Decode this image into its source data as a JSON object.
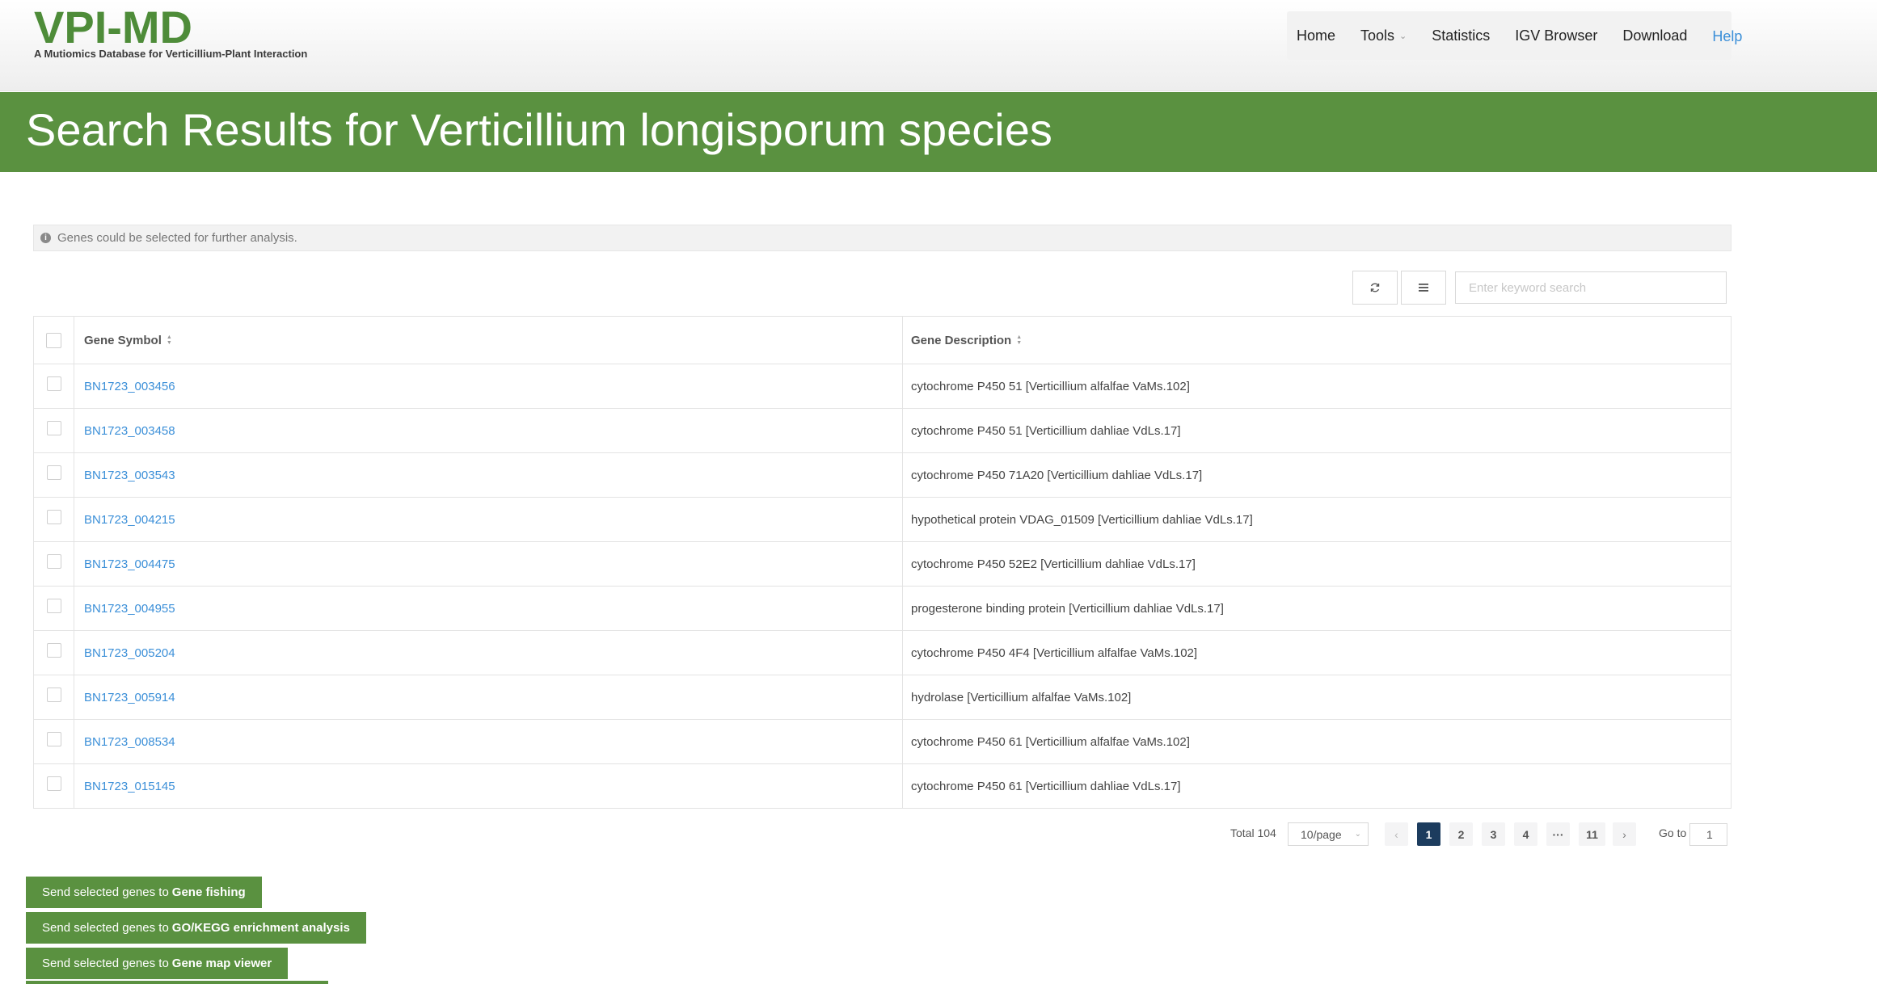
{
  "header": {
    "logo_title": "VPI-MD",
    "logo_subtitle": "A Mutiomics Database for Verticillium-Plant Interaction",
    "nav": [
      {
        "label": "Home"
      },
      {
        "label": "Tools",
        "has_dropdown": true
      },
      {
        "label": "Statistics"
      },
      {
        "label": "IGV Browser"
      },
      {
        "label": "Download"
      },
      {
        "label": "Help",
        "active": true
      }
    ]
  },
  "banner": {
    "title": "Search Results for Verticillium longisporum species"
  },
  "info": {
    "text": "Genes could be selected for further analysis.",
    "icon": "info-circle-icon"
  },
  "toolbar": {
    "refresh_icon": "refresh-icon",
    "columns_icon": "list-icon",
    "search_placeholder": "Enter keyword search",
    "search_value": ""
  },
  "table": {
    "headers": {
      "symbol": "Gene Symbol",
      "description": "Gene Description"
    },
    "rows": [
      {
        "symbol": "BN1723_003456",
        "description": "cytochrome P450 51 [Verticillium alfalfae VaMs.102]"
      },
      {
        "symbol": "BN1723_003458",
        "description": "cytochrome P450 51 [Verticillium dahliae VdLs.17]"
      },
      {
        "symbol": "BN1723_003543",
        "description": "cytochrome P450 71A20 [Verticillium dahliae VdLs.17]"
      },
      {
        "symbol": "BN1723_004215",
        "description": "hypothetical protein VDAG_01509 [Verticillium dahliae VdLs.17]"
      },
      {
        "symbol": "BN1723_004475",
        "description": "cytochrome P450 52E2 [Verticillium dahliae VdLs.17]"
      },
      {
        "symbol": "BN1723_004955",
        "description": "progesterone binding protein [Verticillium dahliae VdLs.17]"
      },
      {
        "symbol": "BN1723_005204",
        "description": "cytochrome P450 4F4 [Verticillium alfalfae VaMs.102]"
      },
      {
        "symbol": "BN1723_005914",
        "description": "hydrolase [Verticillium alfalfae VaMs.102]"
      },
      {
        "symbol": "BN1723_008534",
        "description": "cytochrome P450 61 [Verticillium alfalfae VaMs.102]"
      },
      {
        "symbol": "BN1723_015145",
        "description": "cytochrome P450 61 [Verticillium dahliae VdLs.17]"
      }
    ]
  },
  "pagination": {
    "total_label": "Total 104",
    "page_size": "10/page",
    "pages": [
      "1",
      "2",
      "3",
      "4",
      "···",
      "11"
    ],
    "current_page": "1",
    "prev_icon": "chevron-left-icon",
    "next_icon": "chevron-right-icon",
    "goto_label": "Go to",
    "goto_value": "1"
  },
  "actions": [
    {
      "prefix": "Send selected genes to",
      "target": "Gene fishing"
    },
    {
      "prefix": "Send selected genes to",
      "target": "GO/KEGG enrichment analysis"
    },
    {
      "prefix": "Send selected genes to",
      "target": "Gene map viewer"
    }
  ],
  "colors": {
    "brand_green": "#5a9140",
    "link_blue": "#3b8fd8",
    "active_page": "#1c3c5e"
  }
}
